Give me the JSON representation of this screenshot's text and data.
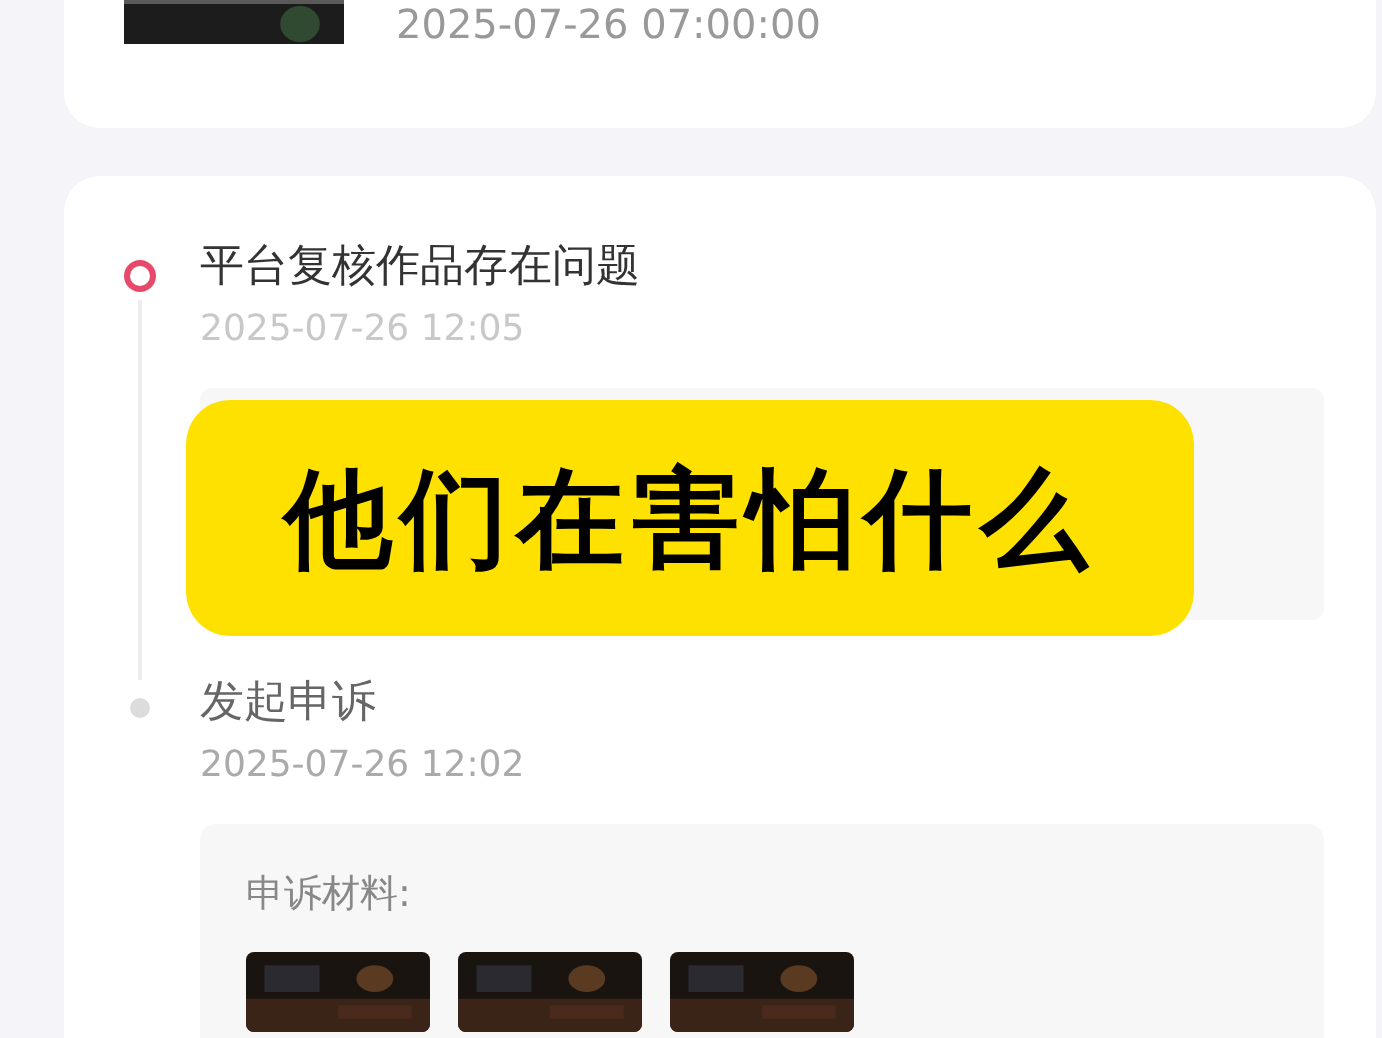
{
  "top_card": {
    "time": "2025-07-26 07:00:00"
  },
  "timeline": [
    {
      "title": "平台复核作品存在问题",
      "time": "2025-07-26 12:05",
      "selected": true
    },
    {
      "title": "发起申诉",
      "time": "2025-07-26 12:02",
      "selected": false
    }
  ],
  "appeal_materials": {
    "label": "申诉材料:"
  },
  "caption": "他们在害怕什么"
}
